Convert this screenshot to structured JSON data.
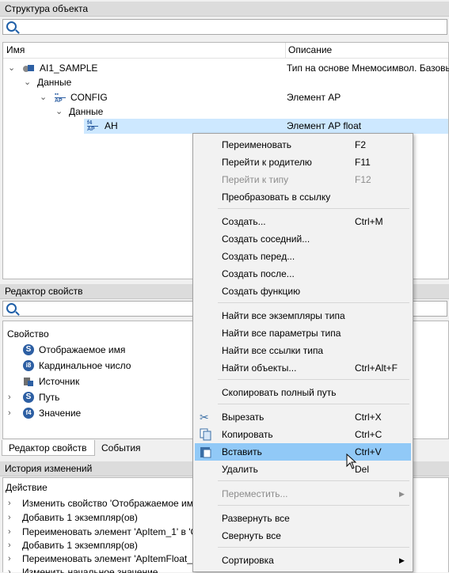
{
  "structure": {
    "title": "Структура объекта",
    "col_name": "Имя",
    "col_desc": "Описание",
    "rows": [
      {
        "name": "AI1_SAMPLE",
        "desc": "Тип на основе Мнемосимвол. Базовы"
      },
      {
        "name": "Данные",
        "desc": ""
      },
      {
        "name": "CONFIG",
        "desc": "Элемент AP"
      },
      {
        "name": "Данные",
        "desc": ""
      },
      {
        "name": "AH",
        "desc": "Элемент AP float"
      }
    ]
  },
  "properties": {
    "title": "Редактор свойств",
    "col_prop": "Свойство",
    "items": [
      {
        "label": "Отображаемое имя",
        "icon": "S"
      },
      {
        "label": "Кардинальное число",
        "icon": "i8"
      },
      {
        "label": "Источник",
        "icon": "source"
      },
      {
        "label": "Путь",
        "icon": "S"
      },
      {
        "label": "Значение",
        "icon": "f4"
      }
    ],
    "tabs": [
      "Редактор свойств",
      "События"
    ]
  },
  "history": {
    "title": "История изменений",
    "col_action": "Действие",
    "items": [
      "Изменить свойство 'Отображаемое им",
      "Добавить 1 экземпляр(ов)",
      "Переименовать элемент 'ApItem_1' в 'C",
      "Добавить 1 экземпляр(ов)",
      "Переименовать элемент 'ApItemFloat_1",
      "Изменить начальное значение"
    ]
  },
  "context_menu": {
    "items": [
      {
        "label": "Переименовать",
        "shortcut": "F2"
      },
      {
        "label": "Перейти к родителю",
        "shortcut": "F11"
      },
      {
        "label": "Перейти к типу",
        "shortcut": "F12"
      },
      {
        "label": "Преобразовать в ссылку",
        "shortcut": ""
      },
      {
        "label": "Создать...",
        "shortcut": "Ctrl+M"
      },
      {
        "label": "Создать соседний...",
        "shortcut": ""
      },
      {
        "label": "Создать перед...",
        "shortcut": ""
      },
      {
        "label": "Создать после...",
        "shortcut": ""
      },
      {
        "label": "Создать функцию",
        "shortcut": ""
      },
      {
        "label": "Найти все экземпляры типа",
        "shortcut": ""
      },
      {
        "label": "Найти все параметры типа",
        "shortcut": ""
      },
      {
        "label": "Найти все ссылки типа",
        "shortcut": ""
      },
      {
        "label": "Найти объекты...",
        "shortcut": "Ctrl+Alt+F"
      },
      {
        "label": "Скопировать полный путь",
        "shortcut": ""
      },
      {
        "label": "Вырезать",
        "shortcut": "Ctrl+X"
      },
      {
        "label": "Копировать",
        "shortcut": "Ctrl+C"
      },
      {
        "label": "Вставить",
        "shortcut": "Ctrl+V"
      },
      {
        "label": "Удалить",
        "shortcut": "Del"
      },
      {
        "label": "Переместить...",
        "shortcut": ""
      },
      {
        "label": "Развернуть все",
        "shortcut": ""
      },
      {
        "label": "Свернуть все",
        "shortcut": ""
      },
      {
        "label": "Сортировка",
        "shortcut": ""
      }
    ]
  },
  "icons": {
    "type_icon_ap": "AP",
    "float_icon": "f4"
  },
  "colors": {
    "selection": "#cde8ff",
    "menu_highlight": "#91c9f7",
    "badge_blue": "#2d5fa3"
  }
}
